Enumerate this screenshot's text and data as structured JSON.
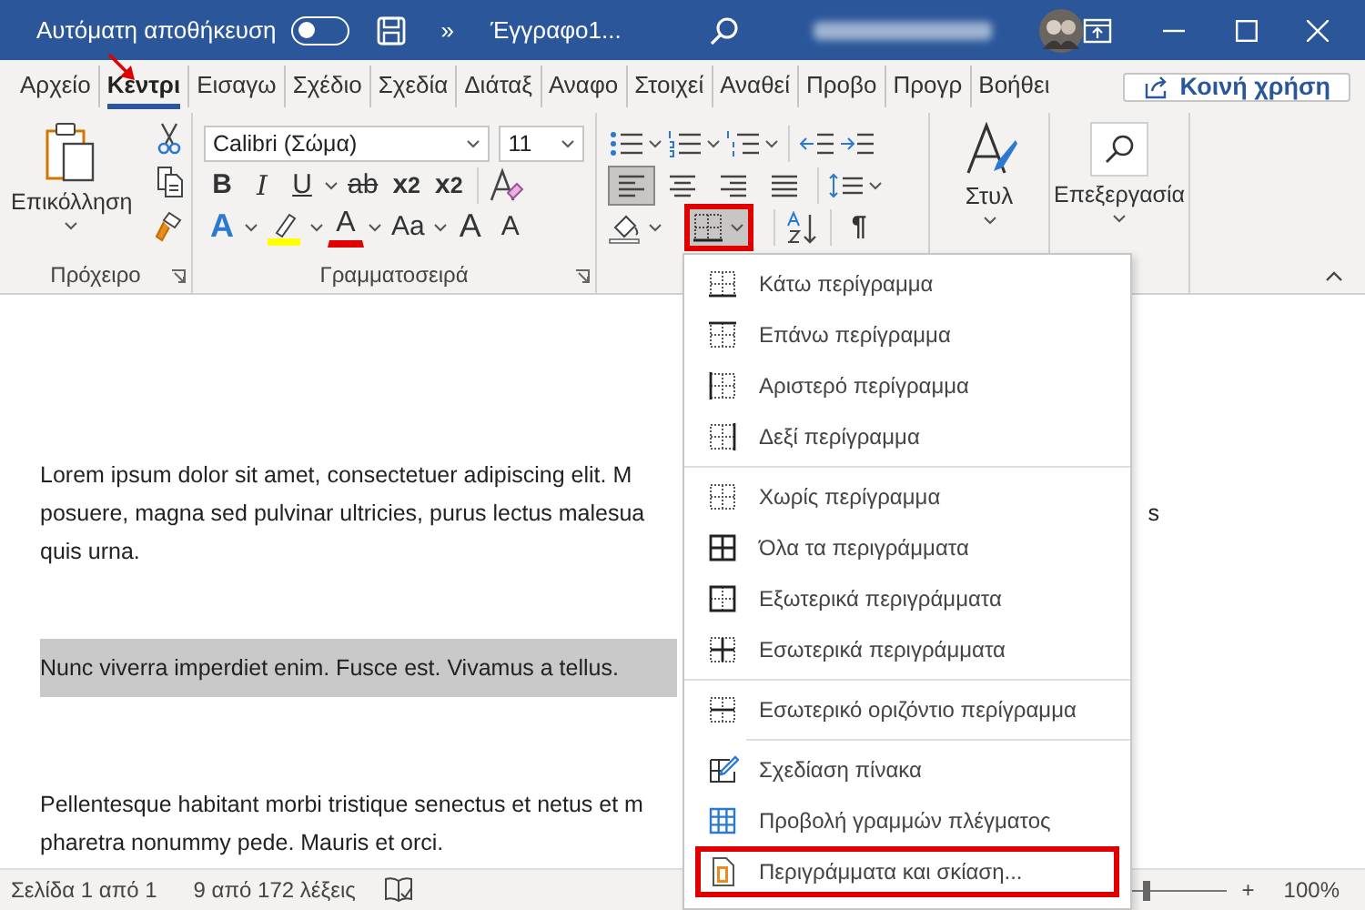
{
  "title_bar": {
    "autosave_label": "Αυτόματη αποθήκευση",
    "autosave_on": false,
    "more": "»",
    "document_title": "Έγγραφο1..."
  },
  "tabs": [
    {
      "label": "Αρχείο",
      "selected": false
    },
    {
      "label": "Κεντρι",
      "selected": true
    },
    {
      "label": "Εισαγω",
      "selected": false
    },
    {
      "label": "Σχέδιο",
      "selected": false
    },
    {
      "label": "Σχεδία",
      "selected": false
    },
    {
      "label": "Διάταξ",
      "selected": false
    },
    {
      "label": "Αναφο",
      "selected": false
    },
    {
      "label": "Στοιχεί",
      "selected": false
    },
    {
      "label": "Αναθεί",
      "selected": false
    },
    {
      "label": "Προβο",
      "selected": false
    },
    {
      "label": "Προγρ",
      "selected": false
    },
    {
      "label": "Βοήθει",
      "selected": false
    }
  ],
  "share_button": "Κοινή χρήση",
  "ribbon": {
    "clipboard": {
      "paste": "Επικόλληση",
      "label": "Πρόχειρο"
    },
    "font": {
      "name": "Calibri (Σώμα)",
      "size": "11",
      "label": "Γραμματοσειρά",
      "row1": [
        {
          "kind": "bold",
          "label": "B"
        },
        {
          "kind": "italic",
          "label": "I"
        },
        {
          "kind": "underline",
          "label": "U"
        },
        {
          "kind": "strike",
          "label": "ab"
        },
        {
          "kind": "sub",
          "label": "x",
          "mark": "2"
        },
        {
          "kind": "sup",
          "label": "x",
          "mark": "2"
        }
      ],
      "row2": [
        {
          "kind": "effects",
          "label": "A"
        },
        {
          "kind": "highlight"
        },
        {
          "kind": "color",
          "label": "A"
        },
        {
          "kind": "case",
          "label": "Aa"
        },
        {
          "kind": "grow",
          "label": "A"
        },
        {
          "kind": "shrink",
          "label": "A"
        }
      ]
    },
    "paragraph": {
      "alignments": [
        {
          "kind": "left",
          "selected": true
        },
        {
          "kind": "center",
          "selected": false
        },
        {
          "kind": "right",
          "selected": false
        },
        {
          "kind": "justify",
          "selected": false
        }
      ],
      "pilcrow": "¶",
      "borders_highlighted": true
    },
    "styles": {
      "label": "Στυλ"
    },
    "editing": {
      "label": "Επεξεργασία"
    }
  },
  "document": {
    "paragraphs": [
      {
        "selected": false,
        "lines": [
          {
            "text": "Lorem ipsum dolor sit amet, consectetuer adipiscing elit. M"
          },
          {
            "text": "posuere, magna sed pulvinar ultricies, purus lectus malesua",
            "tail": "s"
          },
          {
            "text": "quis urna."
          }
        ]
      },
      {
        "selected": true,
        "lines": [
          {
            "text": "Nunc viverra imperdiet enim. Fusce est. Vivamus a tellus."
          }
        ]
      },
      {
        "selected": false,
        "lines": [
          {
            "text": "Pellentesque habitant morbi tristique senectus et netus et m"
          },
          {
            "text": "pharetra nonummy pede. Mauris et orci."
          }
        ]
      }
    ]
  },
  "borders_menu": {
    "groups": [
      [
        {
          "kind": "bottom",
          "label": "Κάτω περίγραμμα",
          "highlighted": false
        },
        {
          "kind": "top",
          "label": "Επάνω περίγραμμα",
          "highlighted": false
        },
        {
          "kind": "left",
          "label": "Αριστερό περίγραμμα",
          "highlighted": false
        },
        {
          "kind": "right",
          "label": "Δεξί περίγραμμα",
          "highlighted": false
        }
      ],
      [
        {
          "kind": "none",
          "label": "Χωρίς περίγραμμα",
          "highlighted": false
        },
        {
          "kind": "all",
          "label": "Όλα τα περιγράμματα",
          "highlighted": false
        },
        {
          "kind": "outside",
          "label": "Εξωτερικά περιγράμματα",
          "highlighted": false
        },
        {
          "kind": "inside",
          "label": "Εσωτερικά περιγράμματα",
          "highlighted": false
        }
      ],
      [
        {
          "kind": "inside-horizontal",
          "label": "Εσωτερικό οριζόντιο περίγραμμα",
          "highlighted": false
        }
      ],
      [
        {
          "kind": "draw-table",
          "label": "Σχεδίαση πίνακα",
          "highlighted": false
        },
        {
          "kind": "gridlines",
          "label": "Προβολή γραμμών πλέγματος",
          "highlighted": false
        },
        {
          "kind": "borders-shading",
          "label": "Περιγράμματα και σκίαση...",
          "highlighted": true
        }
      ]
    ]
  },
  "status_bar": {
    "page": "Σελίδα 1 από 1",
    "words": "9 από 172 λέξεις",
    "zoom_slider": {
      "level": 0.15
    },
    "zoom_plus": "+",
    "zoom": "100%"
  }
}
